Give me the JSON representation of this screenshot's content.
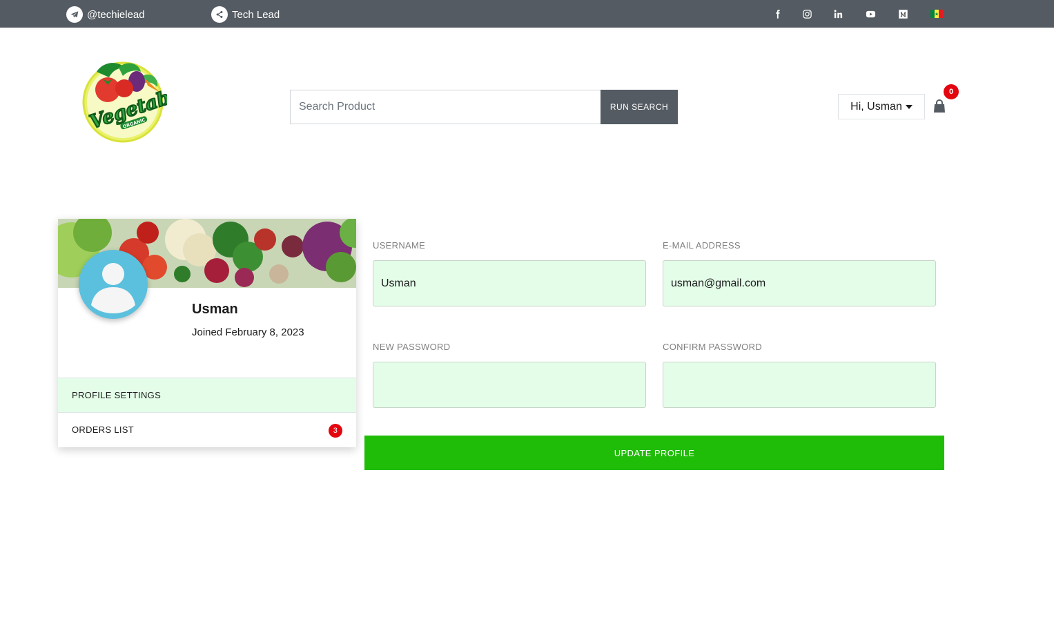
{
  "topbar": {
    "telegram_handle": "@techielead",
    "share_label": "Tech Lead",
    "social_icons": [
      "facebook-icon",
      "instagram-icon",
      "linkedin-icon",
      "youtube-icon",
      "medium-icon",
      "flag-senegal-icon"
    ],
    "background_color": "#545b62"
  },
  "header": {
    "logo_text": "Vegetables",
    "logo_subtext": "ORGANIC",
    "search_placeholder": "Search Product",
    "search_button": "RUN SEARCH",
    "user_menu": "Hi, Usman",
    "cart_count": "0"
  },
  "profile": {
    "name": "Usman",
    "joined": "Joined February 8, 2023",
    "menu": [
      {
        "label": "PROFILE SETTINGS",
        "active": true
      },
      {
        "label": "ORDERS LIST",
        "badge": "3"
      }
    ]
  },
  "form": {
    "username_label": "USERNAME",
    "username_value": "Usman",
    "email_label": "E-MAIL ADDRESS",
    "email_value": "usman@gmail.com",
    "new_password_label": "NEW PASSWORD",
    "new_password_value": "",
    "confirm_password_label": "CONFIRM PASSWORD",
    "confirm_password_value": "",
    "submit_label": "UPDATE PROFILE"
  },
  "colors": {
    "accent_green": "#1fbc08",
    "input_bg": "#e3fde8",
    "badge_red": "#e4060f",
    "avatar_blue": "#5bc0de"
  }
}
